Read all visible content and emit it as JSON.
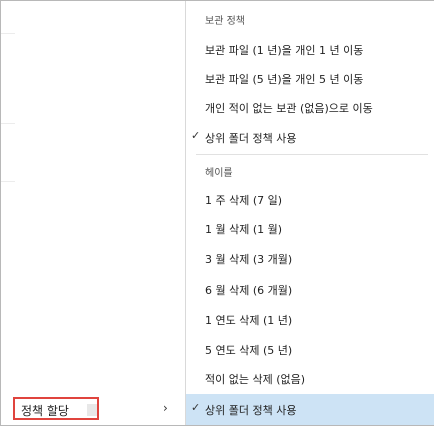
{
  "parent_menu": {
    "item_label": "정책 할당",
    "arrow": "›"
  },
  "submenu": {
    "group1": {
      "heading": "보관 정책",
      "items": [
        "보관 파일 (1 년)을 개인 1 년 이동",
        "보관 파일 (5 년)을 개인 5 년 이동",
        "개인 적이 없는 보관 (없음)으로 이동"
      ],
      "parent_option": {
        "label": "상위 폴더 정책 사용",
        "check": "✓"
      }
    },
    "group2": {
      "heading": "헤이를",
      "items": [
        "1 주 삭제 (7 일)",
        "1 월 삭제 (1 월)",
        "3 월 삭제 (3 개월)",
        "6 월 삭제 (6 개월)",
        "1 연도 삭제 (1 년)",
        "5 연도 삭제 (5 년)",
        "적이 없는 삭제 (없음)"
      ],
      "parent_option": {
        "label": "상위 폴더 정책 사용",
        "check": "✓"
      }
    }
  },
  "colors": {
    "highlight_border": "#e0443e",
    "selected_bg": "#cde3f5"
  }
}
